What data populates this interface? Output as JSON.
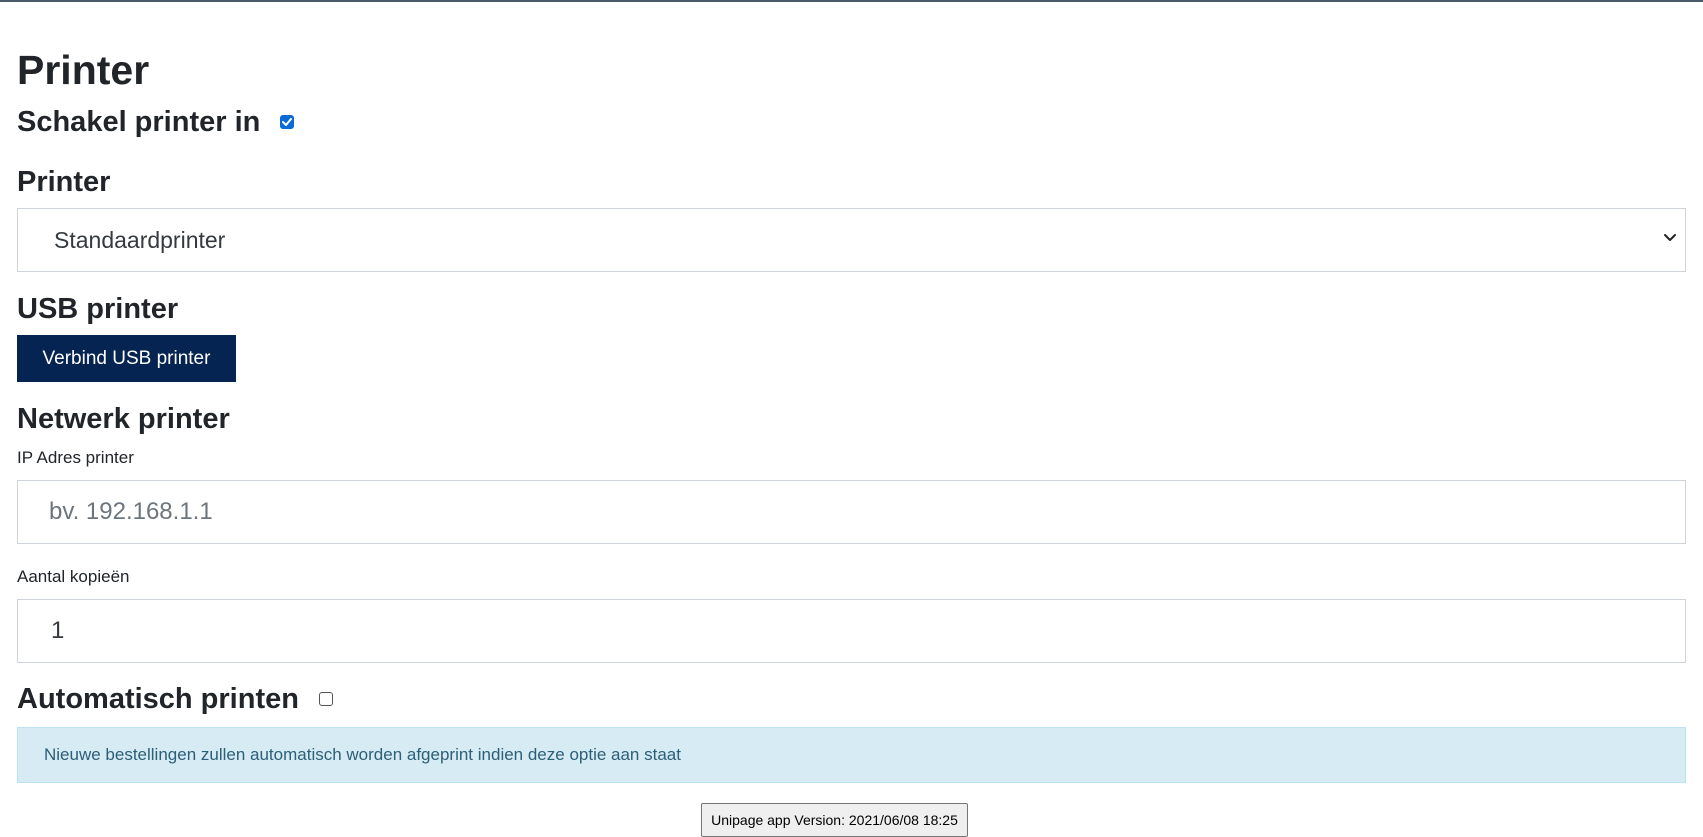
{
  "page": {
    "title": "Printer"
  },
  "enable_printer": {
    "label": "Schakel printer in",
    "checked": true
  },
  "printer_select": {
    "heading": "Printer",
    "selected": "Standaardprinter"
  },
  "usb": {
    "heading": "USB printer",
    "button_label": "Verbind USB printer"
  },
  "network": {
    "heading": "Netwerk printer",
    "ip_label": "IP Adres printer",
    "ip_placeholder": "bv. 192.168.1.1",
    "ip_value": ""
  },
  "copies": {
    "label": "Aantal kopieën",
    "value": "1"
  },
  "auto_print": {
    "label": "Automatisch printen",
    "checked": false,
    "info": "Nieuwe bestellingen zullen automatisch worden afgeprint indien deze optie aan staat"
  },
  "footer": {
    "version_label": "Unipage app Version: 2021/06/08 18:25"
  },
  "colors": {
    "primary_button": "#052451",
    "checkbox_accent": "#0b6bd6",
    "info_background": "#d6ebf3",
    "info_text": "#2c5f78"
  },
  "icons": {
    "select_chevron": "chevron-down-icon",
    "checkmark": "check-icon"
  }
}
